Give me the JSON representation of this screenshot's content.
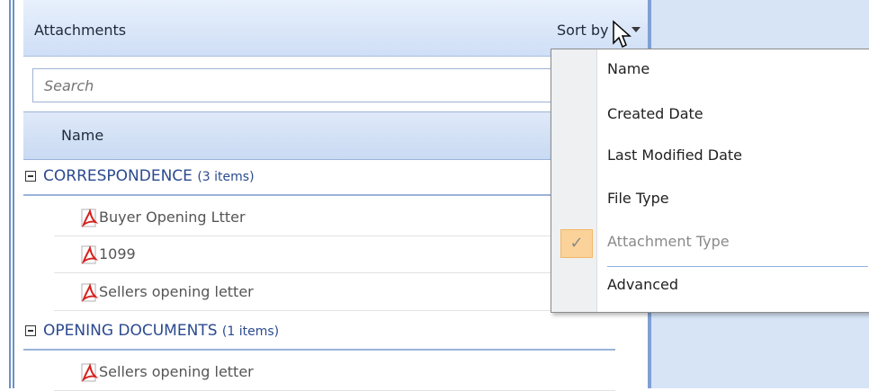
{
  "panel": {
    "title": "Attachments",
    "sort_label": "Sort by"
  },
  "search": {
    "placeholder": "Search"
  },
  "columns": {
    "name": "Name"
  },
  "groups": [
    {
      "title": "CORRESPONDENCE",
      "count": "(3 items)",
      "items": [
        "Buyer Opening Ltter",
        "1099",
        "Sellers opening letter"
      ]
    },
    {
      "title": "OPENING DOCUMENTS",
      "count": "(1 items)",
      "items": [
        "Sellers opening letter"
      ]
    }
  ],
  "sort_menu": {
    "items": [
      {
        "label": "Name",
        "checked": false,
        "disabled": false
      },
      {
        "label": "Created Date",
        "checked": false,
        "disabled": false
      },
      {
        "label": "Last Modified Date",
        "checked": false,
        "disabled": false
      },
      {
        "label": "File Type",
        "checked": false,
        "disabled": false
      },
      {
        "label": "Attachment Type",
        "checked": true,
        "disabled": true
      },
      {
        "label": "Advanced",
        "checked": false,
        "disabled": false
      }
    ],
    "check_glyph": "✓"
  },
  "icons": {
    "pdf": "pdf-file-icon",
    "collapse": "collapse-box-icon",
    "caret": "chevron-down-icon",
    "cursor": "mouse-pointer-icon"
  },
  "colors": {
    "header_bg": "#cfdff6",
    "group_text": "#2b4a8f",
    "check_highlight": "#fbd39a",
    "pdf_red": "#d6211d"
  }
}
